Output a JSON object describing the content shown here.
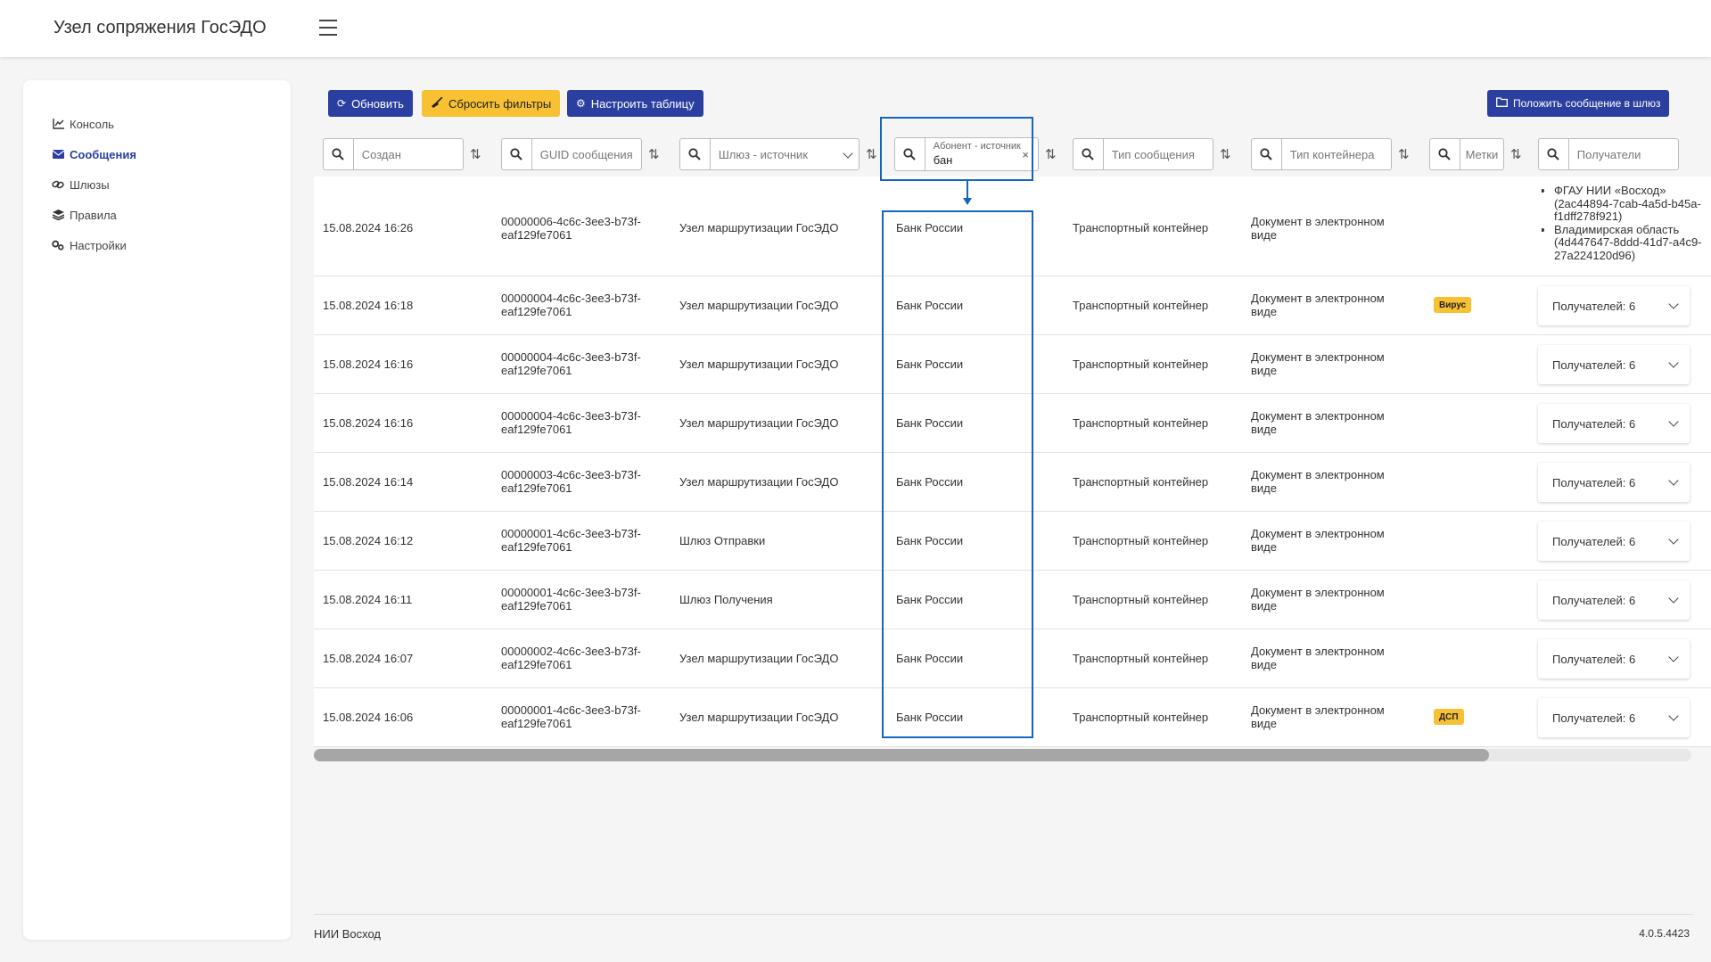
{
  "app": {
    "title": "Узел сопряжения ГосЭДО",
    "org": "НИИ Восход",
    "version": "4.0.5.4423"
  },
  "sidebar": {
    "items": [
      {
        "label": "Консоль",
        "icon": "chart-line-icon"
      },
      {
        "label": "Сообщения",
        "icon": "envelope-icon",
        "active": true
      },
      {
        "label": "Шлюзы",
        "icon": "link-icon"
      },
      {
        "label": "Правила",
        "icon": "layers-icon"
      },
      {
        "label": "Настройки",
        "icon": "gears-icon"
      }
    ]
  },
  "toolbar": {
    "refresh": "Обновить",
    "reset_filters": "Сбросить фильтры",
    "configure_table": "Настроить таблицу",
    "put_message": "Положить сообщение в шлюз"
  },
  "filters": {
    "created": "Создан",
    "guid": "GUID сообщения",
    "gateway_source": "Шлюз - источник",
    "subscriber_source_label": "Абонент - источник",
    "subscriber_source_value": "бан",
    "message_type": "Тип сообщения",
    "container_type": "Тип контейнера",
    "tags": "Метки",
    "recipients": "Получатели"
  },
  "rows": [
    {
      "created": "15.08.2024 16:26",
      "guid1": "00000006-4c6c-3ee3-b73f-",
      "guid2": "eaf129fe7061",
      "gateway": "Узел маршрутизации ГосЭДО",
      "subscriber": "Банк России",
      "msg_type": "Транспортный контейнер",
      "cont1": "Документ в электронном",
      "cont2": "виде",
      "tag": "",
      "recipients_list": [
        "ФГАУ НИИ «Восход» (2ac44894-7cab-4a5d-b45a-f1dff278f921)",
        "Владимирская область (4d447647-8ddd-41d7-a4c9-27a224120d96)"
      ]
    },
    {
      "created": "15.08.2024 16:18",
      "guid1": "00000004-4c6c-3ee3-b73f-",
      "guid2": "eaf129fe7061",
      "gateway": "Узел маршрутизации ГосЭДО",
      "subscriber": "Банк России",
      "msg_type": "Транспортный контейнер",
      "cont1": "Документ в электронном",
      "cont2": "виде",
      "tag": "Вирус",
      "recipients": "Получателей: 6"
    },
    {
      "created": "15.08.2024 16:16",
      "guid1": "00000004-4c6c-3ee3-b73f-",
      "guid2": "eaf129fe7061",
      "gateway": "Узел маршрутизации ГосЭДО",
      "subscriber": "Банк России",
      "msg_type": "Транспортный контейнер",
      "cont1": "Документ в электронном",
      "cont2": "виде",
      "tag": "",
      "recipients": "Получателей: 6"
    },
    {
      "created": "15.08.2024 16:16",
      "guid1": "00000004-4c6c-3ee3-b73f-",
      "guid2": "eaf129fe7061",
      "gateway": "Узел маршрутизации ГосЭДО",
      "subscriber": "Банк России",
      "msg_type": "Транспортный контейнер",
      "cont1": "Документ в электронном",
      "cont2": "виде",
      "tag": "",
      "recipients": "Получателей: 6"
    },
    {
      "created": "15.08.2024 16:14",
      "guid1": "00000003-4c6c-3ee3-b73f-",
      "guid2": "eaf129fe7061",
      "gateway": "Узел маршрутизации ГосЭДО",
      "subscriber": "Банк России",
      "msg_type": "Транспортный контейнер",
      "cont1": "Документ в электронном",
      "cont2": "виде",
      "tag": "",
      "recipients": "Получателей: 6"
    },
    {
      "created": "15.08.2024 16:12",
      "guid1": "00000001-4c6c-3ee3-b73f-",
      "guid2": "eaf129fe7061",
      "gateway": "Шлюз Отправки",
      "subscriber": "Банк России",
      "msg_type": "Транспортный контейнер",
      "cont1": "Документ в электронном",
      "cont2": "виде",
      "tag": "",
      "recipients": "Получателей: 6"
    },
    {
      "created": "15.08.2024 16:11",
      "guid1": "00000001-4c6c-3ee3-b73f-",
      "guid2": "eaf129fe7061",
      "gateway": "Шлюз Получения",
      "subscriber": "Банк России",
      "msg_type": "Транспортный контейнер",
      "cont1": "Документ в электронном",
      "cont2": "виде",
      "tag": "",
      "recipients": "Получателей: 6"
    },
    {
      "created": "15.08.2024 16:07",
      "guid1": "00000002-4c6c-3ee3-b73f-",
      "guid2": "eaf129fe7061",
      "gateway": "Узел маршрутизации ГосЭДО",
      "subscriber": "Банк России",
      "msg_type": "Транспортный контейнер",
      "cont1": "Документ в электронном",
      "cont2": "виде",
      "tag": "",
      "recipients": "Получателей: 6"
    },
    {
      "created": "15.08.2024 16:06",
      "guid1": "00000001-4c6c-3ee3-b73f-",
      "guid2": "eaf129fe7061",
      "gateway": "Узел маршрутизации ГосЭДО",
      "subscriber": "Банк России",
      "msg_type": "Транспортный контейнер",
      "cont1": "Документ в электронном",
      "cont2": "виде",
      "tag": "ДСП",
      "recipients": "Получателей: 6"
    }
  ],
  "colors": {
    "primary": "#2a3fa0",
    "warning": "#f7c133",
    "highlight": "#1565c0"
  }
}
